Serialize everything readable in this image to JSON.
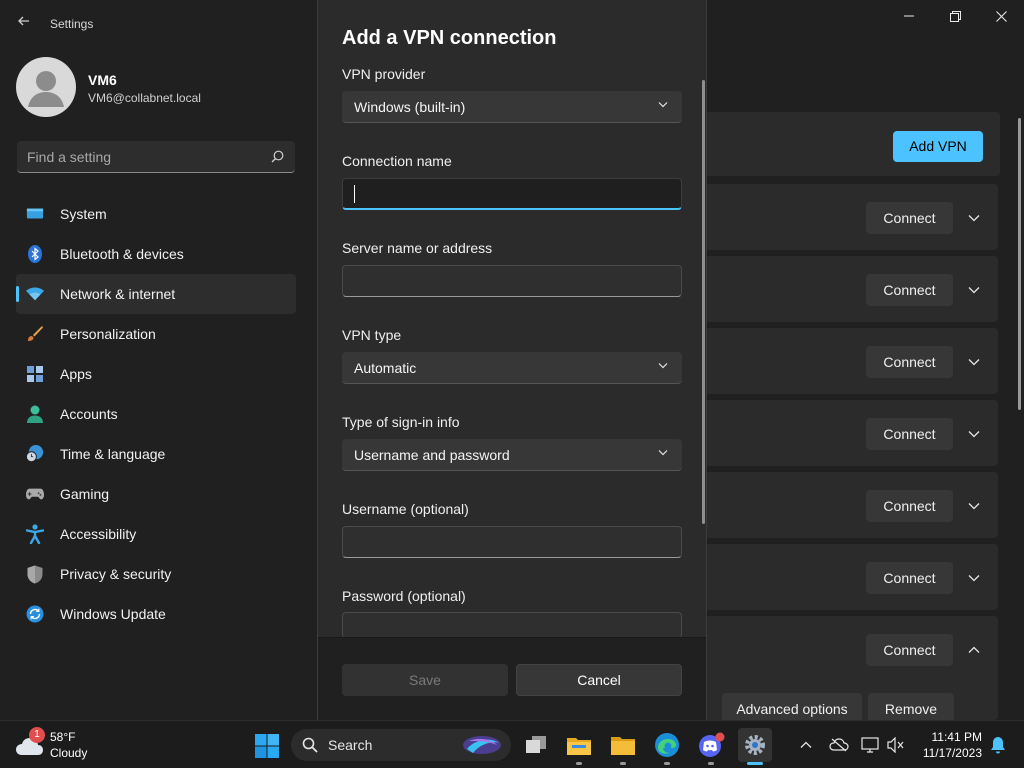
{
  "window": {
    "title": "Settings",
    "back_icon": "back-arrow-icon",
    "controls": [
      "minimize-icon",
      "maximize-icon",
      "close-icon"
    ]
  },
  "user": {
    "name": "VM6",
    "email": "VM6@collabnet.local"
  },
  "search": {
    "placeholder": "Find a setting"
  },
  "sidebar": {
    "items": [
      {
        "label": "System",
        "icon": "system-icon"
      },
      {
        "label": "Bluetooth & devices",
        "icon": "bluetooth-icon"
      },
      {
        "label": "Network & internet",
        "icon": "network-icon",
        "active": true
      },
      {
        "label": "Personalization",
        "icon": "brush-icon"
      },
      {
        "label": "Apps",
        "icon": "apps-icon"
      },
      {
        "label": "Accounts",
        "icon": "accounts-icon"
      },
      {
        "label": "Time & language",
        "icon": "clock-globe-icon"
      },
      {
        "label": "Gaming",
        "icon": "gamepad-icon"
      },
      {
        "label": "Accessibility",
        "icon": "accessibility-icon"
      },
      {
        "label": "Privacy & security",
        "icon": "shield-icon"
      },
      {
        "label": "Windows Update",
        "icon": "update-icon"
      }
    ]
  },
  "vpn_page": {
    "add_button": "Add VPN",
    "connect_label": "Connect",
    "advanced_label": "Advanced options",
    "remove_label": "Remove"
  },
  "dialog": {
    "title": "Add a VPN connection",
    "provider_label": "VPN provider",
    "provider_value": "Windows (built-in)",
    "connection_name_label": "Connection name",
    "connection_name_value": "",
    "server_label": "Server name or address",
    "server_value": "",
    "vpn_type_label": "VPN type",
    "vpn_type_value": "Automatic",
    "signin_label": "Type of sign-in info",
    "signin_value": "Username and password",
    "username_label": "Username (optional)",
    "username_value": "",
    "password_label": "Password (optional)",
    "save_label": "Save",
    "cancel_label": "Cancel"
  },
  "taskbar": {
    "weather_temp": "58°F",
    "weather_desc": "Cloudy",
    "weather_badge": "1",
    "search_label": "Search",
    "apps": [
      "windows-start-icon",
      "task-view-icon",
      "file-explorer-icon",
      "folder-icon",
      "edge-icon",
      "discord-icon",
      "settings-gear-icon"
    ],
    "clock_time": "11:41 PM",
    "clock_date": "11/17/2023"
  },
  "colors": {
    "accent": "#4cc2ff",
    "background": "#202020",
    "card": "#2b2b2b"
  }
}
